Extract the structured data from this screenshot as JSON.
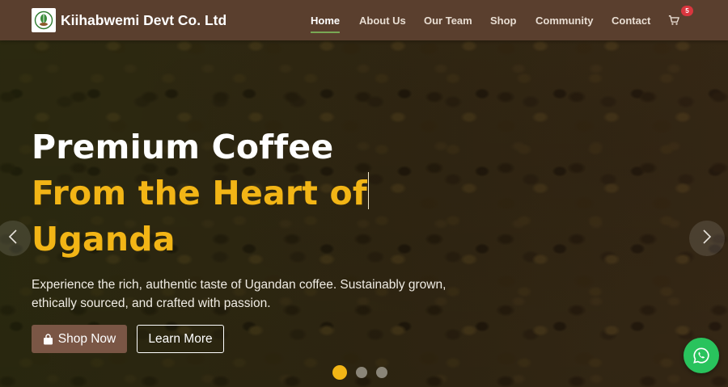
{
  "brand": {
    "name": "Kiihabwemi Devt Co. Ltd",
    "logo_icon": "coffee-leaf-logo"
  },
  "nav": {
    "links": [
      {
        "label": "Home",
        "active": true
      },
      {
        "label": "About Us",
        "active": false
      },
      {
        "label": "Our Team",
        "active": false
      },
      {
        "label": "Shop",
        "active": false
      },
      {
        "label": "Community",
        "active": false
      },
      {
        "label": "Contact",
        "active": false
      }
    ],
    "cart": {
      "icon": "cart-icon",
      "count": "5"
    }
  },
  "hero": {
    "headline_line1": "Premium Coffee",
    "headline_line2": "From the Heart of",
    "headline_line3": "Uganda",
    "description": "Experience the rich, authentic taste of Ugandan coffee. Sustainably grown, ethically sourced, and crafted with passion.",
    "primary_button": {
      "label": "Shop Now",
      "icon": "shopping-bag-icon"
    },
    "secondary_button": {
      "label": "Learn More"
    }
  },
  "carousel": {
    "slide_count": 3,
    "active_index": 0,
    "prev_icon": "chevron-left-icon",
    "next_icon": "chevron-right-icon"
  },
  "whatsapp": {
    "icon": "whatsapp-icon"
  },
  "colors": {
    "navbar": "#5a3f2e",
    "accent_gold": "#f2b516",
    "active_underline": "#79a854",
    "shop_button": "#7a5645",
    "badge": "#d9363e",
    "whatsapp": "#29c35d"
  }
}
